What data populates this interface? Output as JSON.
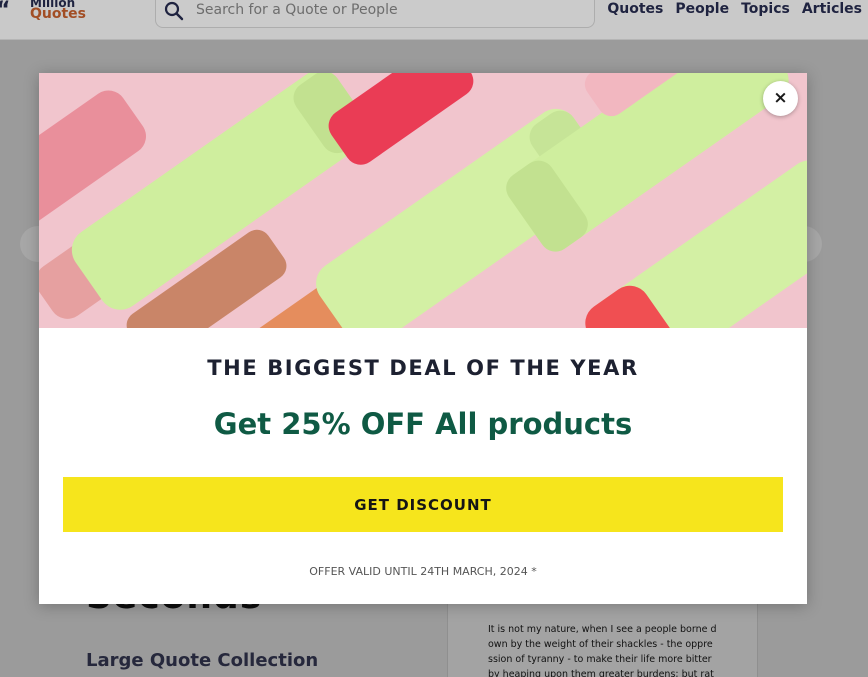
{
  "header": {
    "logo": {
      "mark": "“",
      "million": "Million",
      "quotes": "Quotes"
    },
    "search": {
      "placeholder": "Search for a Quote or People",
      "icon": "search-icon"
    },
    "nav": [
      {
        "label": "Quotes"
      },
      {
        "label": "People"
      },
      {
        "label": "Topics"
      },
      {
        "label": "Articles"
      }
    ]
  },
  "background": {
    "heading": "Seconds",
    "subheading": "Large Quote Collection",
    "card_text": "It is not my nature, when I see a people borne d own by the weight of their shackles - the oppre ssion of tyranny - to make their life more bitter by heaping upon them greater burdens; but rat"
  },
  "modal": {
    "close_label": "×",
    "deal_title": "THE BIGGEST DEAL OF THE YEAR",
    "discount_title": "Get 25% OFF All products",
    "cta_label": "GET DISCOUNT",
    "offer_text": "OFFER VALID UNTIL 24TH MARCH, 2024 *",
    "colors": {
      "hero_background": "#f1c5cd",
      "product_green": "#cfee9e",
      "product_red": "#f04f52",
      "cta_yellow": "#f6e51c",
      "discount_green": "#0f5a44",
      "title_navy": "#1d2131"
    }
  }
}
